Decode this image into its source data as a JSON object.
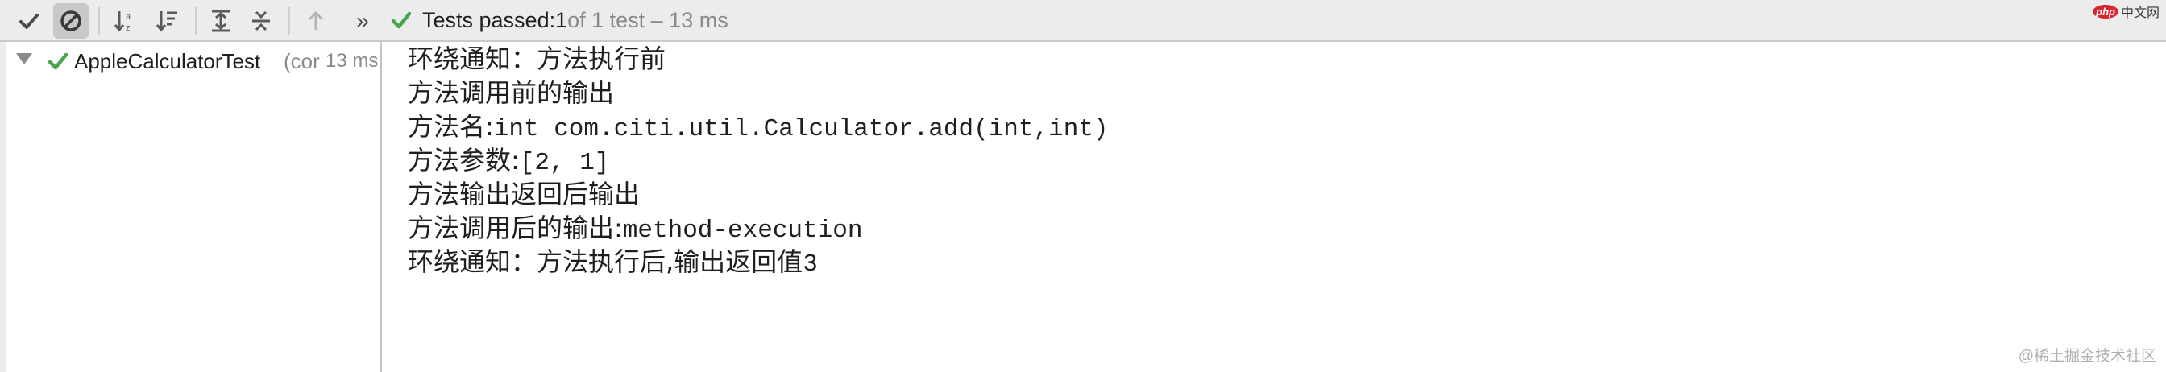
{
  "toolbar": {
    "buttons": [
      {
        "name": "show-passed",
        "icon": "checkmark-icon"
      },
      {
        "name": "show-ignored",
        "icon": "cancel-circle-icon",
        "pressed": true
      },
      {
        "name": "sort-alphabetically",
        "icon": "sort-az-icon"
      },
      {
        "name": "sort-by-duration",
        "icon": "sort-duration-icon"
      },
      {
        "name": "expand-all",
        "icon": "expand-all-icon"
      },
      {
        "name": "collapse-all",
        "icon": "collapse-all-icon"
      },
      {
        "name": "previous-failed",
        "icon": "arrow-up-icon"
      },
      {
        "name": "more",
        "icon": "double-chevron-right-icon"
      }
    ],
    "more_label": "»"
  },
  "status": {
    "prefix": "Tests passed: ",
    "passed_count": "1",
    "of_text": " of 1 test – 13 ms",
    "ok_color": "#4aa44e"
  },
  "logo": {
    "php": "php",
    "text": "中文网"
  },
  "tree": {
    "items": [
      {
        "name": "AppleCalculatorTest",
        "class_hint": "(cor",
        "time": "13 ms",
        "status_icon": "checkmark-icon",
        "expanded": true
      }
    ]
  },
  "console": {
    "lines": [
      {
        "cn": "环绕通知：方法执行前",
        "mono": ""
      },
      {
        "cn": "方法调用前的输出",
        "mono": ""
      },
      {
        "cn": "方法名:",
        "mono": "int com.citi.util.Calculator.add(int,int)"
      },
      {
        "cn": "方法参数:",
        "mono": "[2, 1]"
      },
      {
        "cn": "方法输出返回后输出",
        "mono": ""
      },
      {
        "cn": "方法调用后的输出:",
        "mono": "method-execution"
      },
      {
        "cn": "环绕通知：方法执行后,输出返回值",
        "mono": "3"
      }
    ]
  },
  "watermark": "@稀土掘金技术社区",
  "colors": {
    "accent_green": "#4aa44e",
    "toolbar_bg": "#ececec",
    "icon_gray": "#5a5a5a"
  }
}
